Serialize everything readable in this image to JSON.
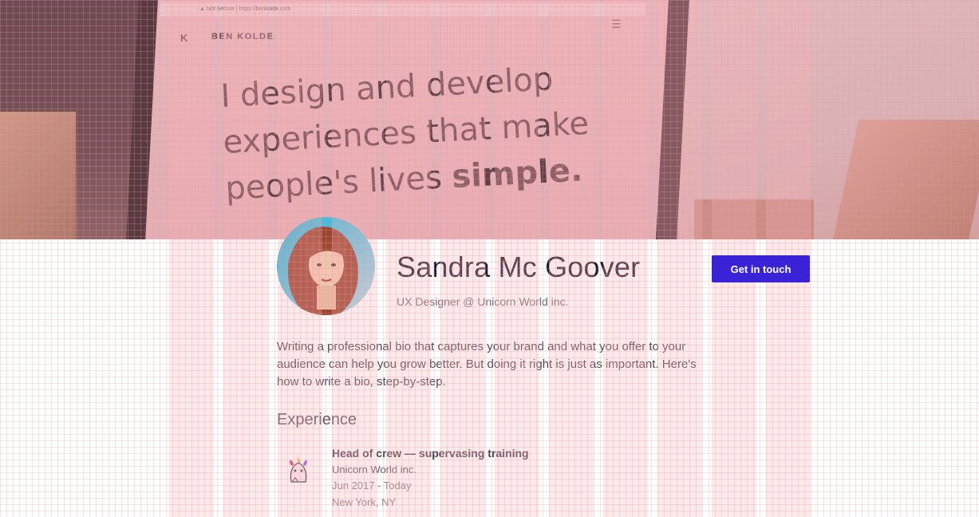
{
  "hero": {
    "browser_url": "▲ Not Secure | https://benkolde.com",
    "site_logo": "K",
    "site_brand": "BEN KOLDE",
    "site_menu_icon": "hamburger-icon",
    "headline_line1": "I design and develop",
    "headline_line2": "experiences that make",
    "headline_line3_plain": "people's lives ",
    "headline_line3_bold": "simple."
  },
  "profile": {
    "name": "Sandra Mc Goover",
    "title": "UX Designer @ Unicorn World inc.",
    "cta_label": "Get in touch",
    "bio": "Writing a professional bio that captures your brand and what you offer to your audience can help you grow better. But doing it right is just as important. Here's how to write a bio, step-by-step."
  },
  "experience": {
    "heading": "Experience",
    "items": [
      {
        "logo_icon": "unicorn-logo-icon",
        "role": "Head of crew — supervasing training",
        "company": "Unicorn World inc.",
        "dates": "Jun 2017 - Today",
        "location": "New York, NY"
      }
    ]
  },
  "colors": {
    "accent": "#3a23d6",
    "grid_overlay": "#f5a9b0"
  }
}
